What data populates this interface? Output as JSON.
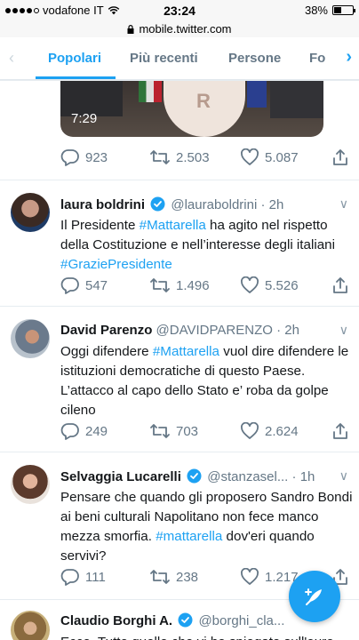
{
  "status_bar": {
    "carrier": "vodafone IT",
    "time": "23:24",
    "battery": "38%",
    "battery_level": 0.38
  },
  "url_bar": {
    "url": "mobile.twitter.com"
  },
  "tabs": {
    "items": [
      {
        "label": "Popolari",
        "active": true
      },
      {
        "label": "Più recenti",
        "active": false
      },
      {
        "label": "Persone",
        "active": false
      },
      {
        "label": "Fo",
        "active": false
      }
    ]
  },
  "first_tweet": {
    "video_duration": "7:29",
    "replies": "923",
    "retweets": "2.503",
    "likes": "5.087"
  },
  "tweets": [
    {
      "name": "laura boldrini",
      "handle": "@lauraboldrini",
      "time": "· 2h",
      "verified": true,
      "text_parts": [
        {
          "t": "Il Presidente ",
          "tag": false
        },
        {
          "t": "#Mattarella",
          "tag": true
        },
        {
          "t": " ha agito nel rispetto della Costituzione e nell’interesse degli italiani ",
          "tag": false
        },
        {
          "t": "#GraziePresidente",
          "tag": true
        }
      ],
      "replies": "547",
      "retweets": "1.496",
      "likes": "5.526"
    },
    {
      "name": "David Parenzo",
      "handle": "@DAVIDPARENZO",
      "time": "· 2h",
      "verified": false,
      "text_parts": [
        {
          "t": "Oggi difendere ",
          "tag": false
        },
        {
          "t": "#Mattarella",
          "tag": true
        },
        {
          "t": " vuol dire difendere le istituzioni democratiche di questo Paese. L’attacco al capo dello Stato e’ roba da golpe cileno",
          "tag": false
        }
      ],
      "replies": "249",
      "retweets": "703",
      "likes": "2.624"
    },
    {
      "name": "Selvaggia Lucarelli",
      "handle": "@stanzasel...",
      "time": "· 1h",
      "verified": true,
      "text_parts": [
        {
          "t": "Pensare che quando gli proposero Sandro Bondi ai beni culturali Napolitano non fece manco mezza smorfia. ",
          "tag": false
        },
        {
          "t": "#mattarella",
          "tag": true
        },
        {
          "t": " dov'eri quando servivi?",
          "tag": false
        }
      ],
      "replies": "111",
      "retweets": "238",
      "likes": "1.217"
    },
    {
      "name": "Claudio Borghi A.",
      "handle": "@borghi_cla...",
      "time": "",
      "verified": true,
      "text_parts": [
        {
          "t": "Ecco. Tutto quello che vi ho spiegato sull'euro",
          "tag": false
        }
      ]
    }
  ]
}
